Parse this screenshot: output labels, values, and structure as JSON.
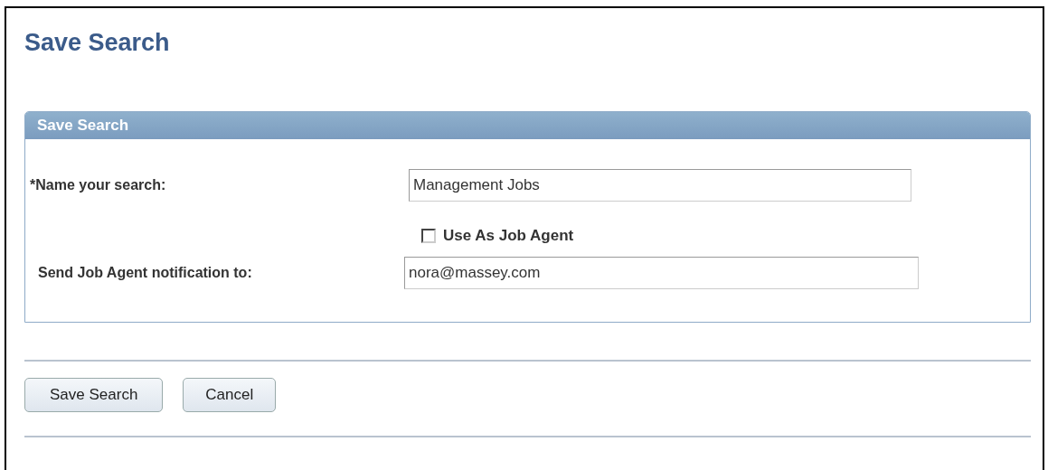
{
  "page_title": "Save Search",
  "panel": {
    "title": "Save Search",
    "fields": [
      {
        "kind": "text",
        "label": "*Name your search:",
        "value": "Management Jobs"
      },
      {
        "kind": "checkbox",
        "label": "Use As Job Agent",
        "checked": false
      },
      {
        "kind": "text",
        "label": "Send Job Agent notification to:",
        "value": "nora@massey.com"
      }
    ]
  },
  "buttons": [
    "Save Search",
    "Cancel"
  ]
}
